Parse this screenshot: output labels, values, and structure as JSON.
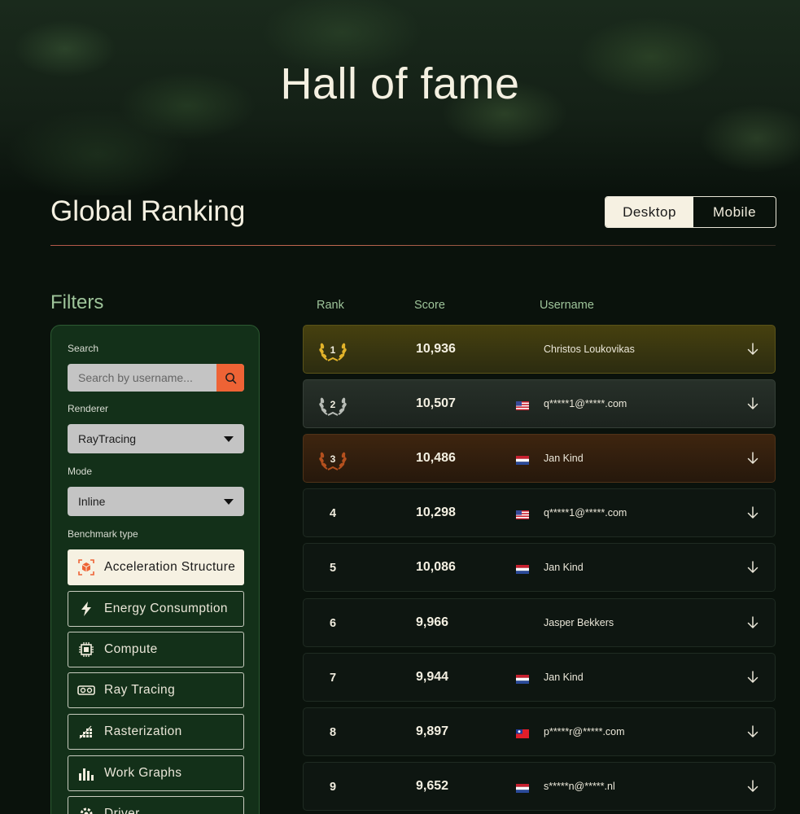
{
  "hero": {
    "title": "Hall of fame"
  },
  "ranking": {
    "title": "Global Ranking",
    "toggle": [
      {
        "label": "Desktop",
        "active": true
      },
      {
        "label": "Mobile",
        "active": false
      }
    ]
  },
  "filters": {
    "title": "Filters",
    "search_label": "Search",
    "search_placeholder": "Search by username...",
    "renderer_label": "Renderer",
    "renderer_value": "RayTracing",
    "mode_label": "Mode",
    "mode_value": "Inline",
    "benchmark_label": "Benchmark type",
    "benchmarks": [
      {
        "label": "Acceleration Structure",
        "icon": "cube-icon",
        "active": true
      },
      {
        "label": "Energy Consumption",
        "icon": "lightning-icon",
        "active": false
      },
      {
        "label": "Compute",
        "icon": "chip-icon",
        "active": false
      },
      {
        "label": "Ray Tracing",
        "icon": "vr-headset-icon",
        "active": false
      },
      {
        "label": "Rasterization",
        "icon": "rasterization-icon",
        "active": false
      },
      {
        "label": "Work Graphs",
        "icon": "bar-chart-icon",
        "active": false
      },
      {
        "label": "Driver",
        "icon": "gear-icon",
        "active": false
      }
    ]
  },
  "table": {
    "headers": {
      "rank": "Rank",
      "score": "Score",
      "username": "Username"
    },
    "rows": [
      {
        "rank": "1",
        "score": "10,936",
        "flag": "",
        "username": "Christos Loukovikas"
      },
      {
        "rank": "2",
        "score": "10,507",
        "flag": "us",
        "username": "q*****1@*****.com"
      },
      {
        "rank": "3",
        "score": "10,486",
        "flag": "nl",
        "username": "Jan Kind"
      },
      {
        "rank": "4",
        "score": "10,298",
        "flag": "us",
        "username": "q*****1@*****.com"
      },
      {
        "rank": "5",
        "score": "10,086",
        "flag": "nl",
        "username": "Jan Kind"
      },
      {
        "rank": "6",
        "score": "9,966",
        "flag": "",
        "username": "Jasper Bekkers"
      },
      {
        "rank": "7",
        "score": "9,944",
        "flag": "nl",
        "username": "Jan Kind"
      },
      {
        "rank": "8",
        "score": "9,897",
        "flag": "tw",
        "username": "p*****r@*****.com"
      },
      {
        "rank": "9",
        "score": "9,652",
        "flag": "nl",
        "username": "s*****n@*****.nl"
      }
    ]
  },
  "colors": {
    "gold": "#e2b32a",
    "silver": "#b8bcb6",
    "bronze": "#b4501e",
    "accent": "#ee6335",
    "filter_green": "#9ec49a"
  }
}
